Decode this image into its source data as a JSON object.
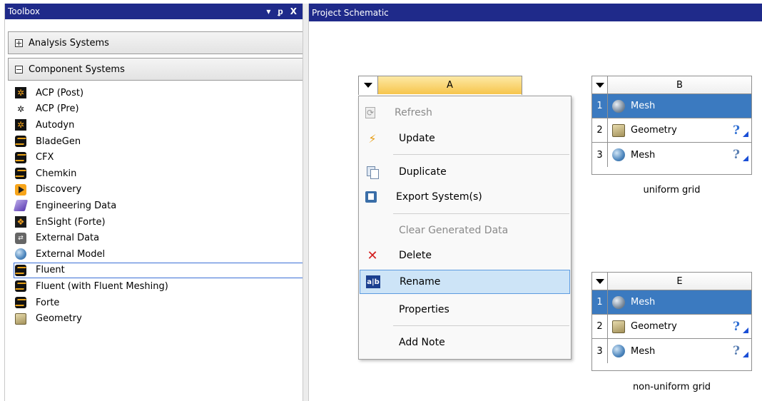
{
  "toolbox": {
    "title": "Toolbox",
    "controls": {
      "dropdown": "▾",
      "pin": "ᵱ",
      "close": "X"
    },
    "groups": [
      {
        "label": "Analysis Systems",
        "expanded": false
      },
      {
        "label": "Component Systems",
        "expanded": true
      }
    ],
    "items": [
      {
        "label": "ACP (Post)",
        "icon": "acp-post-icon"
      },
      {
        "label": "ACP (Pre)",
        "icon": "acp-pre-icon"
      },
      {
        "label": "Autodyn",
        "icon": "autodyn-icon"
      },
      {
        "label": "BladeGen",
        "icon": "bladegen-icon"
      },
      {
        "label": "CFX",
        "icon": "cfx-icon"
      },
      {
        "label": "Chemkin",
        "icon": "chemkin-icon"
      },
      {
        "label": "Discovery",
        "icon": "discovery-icon"
      },
      {
        "label": "Engineering Data",
        "icon": "engineering-data-icon"
      },
      {
        "label": "EnSight (Forte)",
        "icon": "ensight-icon"
      },
      {
        "label": "External Data",
        "icon": "external-data-icon"
      },
      {
        "label": "External Model",
        "icon": "external-model-icon"
      },
      {
        "label": "Fluent",
        "icon": "fluent-icon"
      },
      {
        "label": "Fluent (with Fluent Meshing)",
        "icon": "fluent-meshing-icon"
      },
      {
        "label": "Forte",
        "icon": "forte-icon"
      },
      {
        "label": "Geometry",
        "icon": "geometry-icon"
      }
    ]
  },
  "schematic": {
    "title": "Project Schematic",
    "systems": {
      "a": {
        "letter": "A"
      },
      "b": {
        "letter": "B",
        "caption": "uniform grid",
        "rows": [
          {
            "num": "1",
            "label": "Mesh"
          },
          {
            "num": "2",
            "label": "Geometry",
            "status": "?"
          },
          {
            "num": "3",
            "label": "Mesh",
            "status": "?"
          }
        ]
      },
      "e": {
        "letter": "E",
        "caption": "non-uniform grid",
        "rows": [
          {
            "num": "1",
            "label": "Mesh"
          },
          {
            "num": "2",
            "label": "Geometry",
            "status": "?"
          },
          {
            "num": "3",
            "label": "Mesh",
            "status": "?"
          }
        ]
      }
    }
  },
  "context_menu": {
    "items": [
      {
        "label": "Refresh",
        "icon": "refresh-icon",
        "disabled": true
      },
      {
        "label": "Update",
        "icon": "update-icon"
      },
      {
        "label": "Duplicate",
        "icon": "duplicate-icon"
      },
      {
        "label": "Export System(s)",
        "icon": "export-icon"
      },
      {
        "label": "Clear Generated Data",
        "disabled": true
      },
      {
        "label": "Delete",
        "icon": "delete-icon"
      },
      {
        "label": "Rename",
        "icon": "rename-icon",
        "highlighted": true
      },
      {
        "label": "Properties"
      },
      {
        "label": "Add Note"
      }
    ]
  },
  "colors": {
    "titlebar": "#1f2a8a",
    "selection": "#3b7ac0",
    "menu_highlight": "#cde4f7",
    "header_active": "#f6c54c"
  }
}
